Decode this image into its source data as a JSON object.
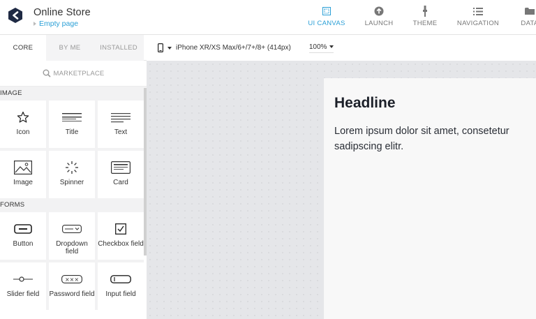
{
  "header": {
    "app_title": "Online Store",
    "page_name": "Empty page",
    "nav": [
      {
        "label": "UI CANVAS",
        "icon": "canvas-icon",
        "active": true
      },
      {
        "label": "LAUNCH",
        "icon": "upload-icon",
        "active": false
      },
      {
        "label": "THEME",
        "icon": "brush-icon",
        "active": false
      },
      {
        "label": "NAVIGATION",
        "icon": "list-icon",
        "active": false
      },
      {
        "label": "DATA",
        "icon": "folder-icon",
        "active": false
      }
    ]
  },
  "sidebar": {
    "tabs": [
      {
        "label": "CORE",
        "active": true
      },
      {
        "label": "BY ME",
        "active": false
      },
      {
        "label": "INSTALLED",
        "active": false
      }
    ],
    "marketplace_label": "MARKETPLACE",
    "sections": [
      {
        "title": "IMAGE",
        "items": [
          {
            "label": "Icon",
            "icon": "star-icon"
          },
          {
            "label": "Title",
            "icon": "title-icon"
          },
          {
            "label": "Text",
            "icon": "text-icon"
          },
          {
            "label": "Image",
            "icon": "image-icon"
          },
          {
            "label": "Spinner",
            "icon": "spinner-icon"
          },
          {
            "label": "Card",
            "icon": "card-icon"
          }
        ]
      },
      {
        "title": "FORMS",
        "items": [
          {
            "label": "Button",
            "icon": "button-icon"
          },
          {
            "label": "Dropdown field",
            "icon": "dropdown-icon"
          },
          {
            "label": "Checkbox field",
            "icon": "checkbox-icon"
          },
          {
            "label": "Slider field",
            "icon": "slider-icon"
          },
          {
            "label": "Password field",
            "icon": "password-icon"
          },
          {
            "label": "Input field",
            "icon": "input-icon"
          }
        ]
      }
    ]
  },
  "toolbar": {
    "device": "iPhone XR/XS Max/6+/7+/8+ (414px)",
    "zoom": "100%"
  },
  "canvas": {
    "headline": "Headline",
    "body": "Lorem ipsum dolor sit amet, consetetur sadipscing elitr."
  },
  "colors": {
    "accent": "#2a9fd6",
    "canvas_bg": "#e5e6e9",
    "headline": "#1c2029"
  }
}
